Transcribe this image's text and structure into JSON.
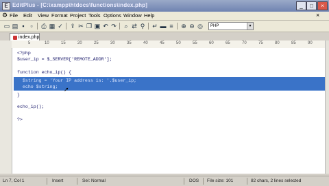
{
  "window": {
    "title": "EditPlus - [C:\\xampp\\htdocs\\functions\\index.php]",
    "app_icon": "E",
    "min": "_",
    "max": "□",
    "close": "×"
  },
  "menu": {
    "items": [
      "File",
      "Edit",
      "View",
      "Format",
      "Project",
      "Tools",
      "Options",
      "Window",
      "Help"
    ]
  },
  "toolbar": {
    "language": "PHP"
  },
  "tab": {
    "label": "index.php"
  },
  "ruler": {
    "marks": [
      "5",
      "10",
      "15",
      "20",
      "25",
      "30",
      "35",
      "40",
      "45",
      "50",
      "55",
      "60",
      "65",
      "70",
      "75",
      "80",
      "85",
      "90"
    ]
  },
  "code": {
    "lines": [
      "<?php",
      "$user_ip = $_SERVER['REMOTE_ADDR'];",
      "",
      "function echo_ip() {",
      "  $string = 'Your IP address is: '.$user_ip;",
      "  echo $string;",
      "}",
      "",
      "echo_ip();",
      "",
      "?>"
    ]
  },
  "status": {
    "position": "Ln 7, Col 1",
    "mode": "Insert",
    "selection_mode": "Sel: Normal",
    "encoding": "DOS",
    "file_size": "File size: 101",
    "summary": "82 chars, 2 lines selected"
  }
}
